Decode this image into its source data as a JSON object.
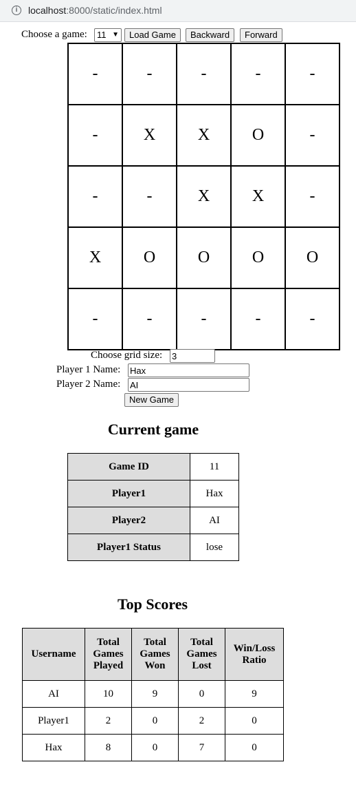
{
  "browser": {
    "url_host": "localhost",
    "url_rest": ":8000/static/index.html"
  },
  "controls": {
    "choose_game_label": "Choose a game:",
    "selected_game": "11",
    "load_game": "Load Game",
    "backward": "Backward",
    "forward": "Forward"
  },
  "board": [
    [
      "-",
      "-",
      "-",
      "-",
      "-"
    ],
    [
      "-",
      "X",
      "X",
      "O",
      "-"
    ],
    [
      "-",
      "-",
      "X",
      "X",
      "-"
    ],
    [
      "X",
      "O",
      "O",
      "O",
      "O"
    ],
    [
      "-",
      "-",
      "-",
      "-",
      "-"
    ]
  ],
  "new_game_form": {
    "grid_size_label": "Choose grid size:",
    "grid_size_value": "3",
    "player1_label": "Player 1 Name:",
    "player1_value": "Hax",
    "player2_label": "Player 2 Name:",
    "player2_value": "AI",
    "new_game_button": "New Game"
  },
  "current_game": {
    "title": "Current game",
    "rows": [
      {
        "label": "Game ID",
        "value": "11"
      },
      {
        "label": "Player1",
        "value": "Hax"
      },
      {
        "label": "Player2",
        "value": "AI"
      },
      {
        "label": "Player1 Status",
        "value": "lose"
      }
    ]
  },
  "top_scores": {
    "title": "Top Scores",
    "headers": [
      "Username",
      "Total Games Played",
      "Total Games Won",
      "Total Games Lost",
      "Win/Loss Ratio"
    ],
    "rows": [
      [
        "AI",
        "10",
        "9",
        "0",
        "9"
      ],
      [
        "Player1",
        "2",
        "0",
        "2",
        "0"
      ],
      [
        "Hax",
        "8",
        "0",
        "7",
        "0"
      ]
    ]
  }
}
